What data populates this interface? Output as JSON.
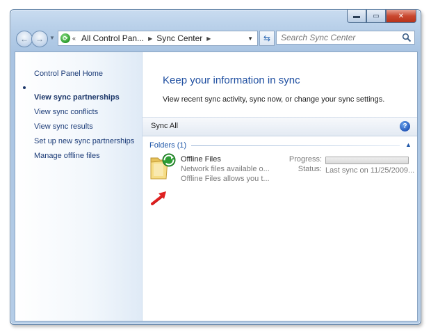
{
  "address_bar": {
    "crumbs": [
      "All Control Pan...",
      "Sync Center"
    ],
    "prefix": "«"
  },
  "search": {
    "placeholder": "Search Sync Center"
  },
  "left_nav": {
    "items": [
      {
        "label": "Control Panel Home"
      },
      {
        "label": "View sync partnerships"
      },
      {
        "label": "View sync conflicts"
      },
      {
        "label": "View sync results"
      },
      {
        "label": "Set up new sync partnerships"
      },
      {
        "label": "Manage offline files"
      }
    ]
  },
  "main": {
    "heading": "Keep your information in sync",
    "subtext": "View recent sync activity, sync now, or change your sync settings.",
    "toolbar": {
      "sync_all": "Sync All"
    },
    "group": {
      "title": "Folders (1)",
      "items": [
        {
          "name": "Offline Files",
          "line1": "Network files available o...",
          "line2": "Offline Files allows you t...",
          "progress_label": "Progress:",
          "progress": 0,
          "status_label": "Status:",
          "status": "Last sync on 11/25/2009..."
        }
      ]
    }
  },
  "colors": {
    "link": "#1c3c78",
    "heading": "#1e4ea0",
    "close_button": "#c9482f",
    "annotation_arrow": "#e02020"
  }
}
